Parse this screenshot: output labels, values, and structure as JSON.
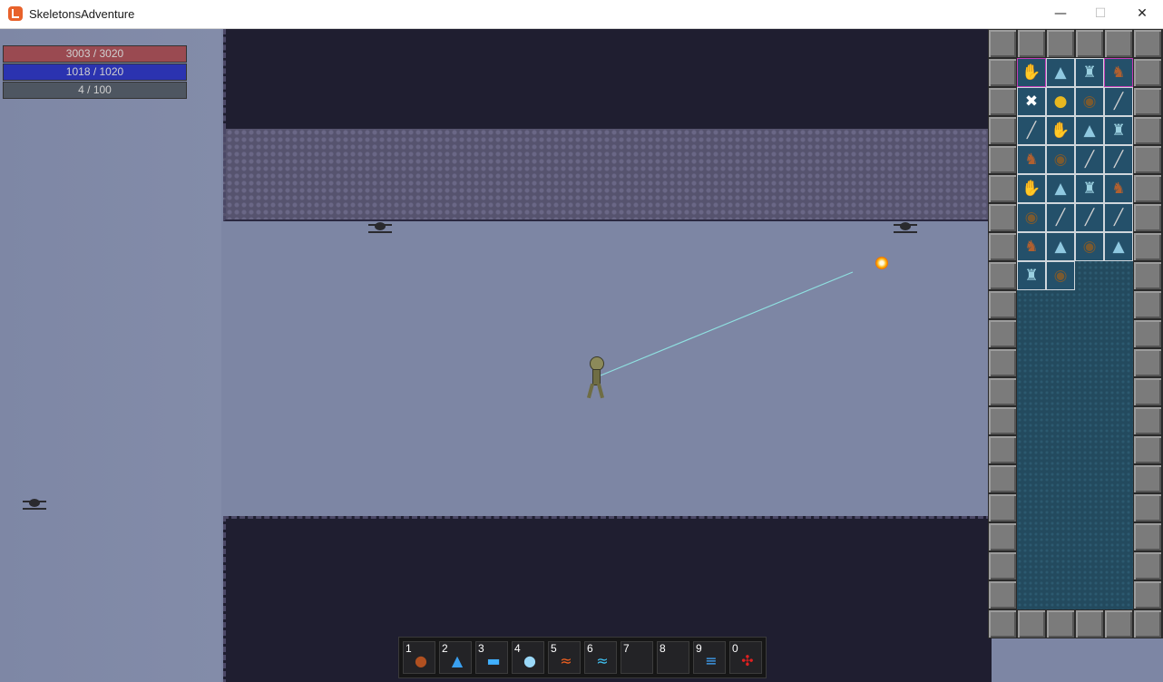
{
  "window": {
    "title": "SkeletonsAdventure",
    "minimize_glyph": "—",
    "maximize_glyph": "☐",
    "close_glyph": "✕"
  },
  "stats": {
    "health": "3003 / 3020",
    "mana": "1018 / 1020",
    "xp": "4 / 100"
  },
  "colors": {
    "health": "#9a4a51",
    "mana": "#2b33b0",
    "xp": "#4e5661",
    "laser": "#8fe0e0",
    "floor": "#7d86a4",
    "wall_dark": "#1f1e30"
  },
  "inventory": {
    "items": [
      {
        "icon": "glove-icon",
        "glyph": "✋",
        "color": "#8a6a3a",
        "highlighted": true
      },
      {
        "icon": "wizard-hat-icon",
        "glyph": "▲",
        "color": "#8fc8e0",
        "highlighted": false
      },
      {
        "icon": "robe-icon",
        "glyph": "♜",
        "color": "#9ad0e0",
        "highlighted": false
      },
      {
        "icon": "boots-icon",
        "glyph": "♞",
        "color": "#b06030",
        "highlighted": true
      },
      {
        "icon": "crossbones-icon",
        "glyph": "✖",
        "color": "#ffffff",
        "highlighted": false
      },
      {
        "icon": "gold-coins-icon",
        "glyph": "●",
        "color": "#e8b820",
        "highlighted": false
      },
      {
        "icon": "shield-icon",
        "glyph": "◉",
        "color": "#7a5a30",
        "highlighted": false
      },
      {
        "icon": "sword-icon",
        "glyph": "╱",
        "color": "#d0d0d0",
        "highlighted": false
      },
      {
        "icon": "sword-icon",
        "glyph": "╱",
        "color": "#d0d0d0",
        "highlighted": false
      },
      {
        "icon": "glove-icon",
        "glyph": "✋",
        "color": "#8a6a3a",
        "highlighted": false
      },
      {
        "icon": "wizard-hat-icon",
        "glyph": "▲",
        "color": "#8fc8e0",
        "highlighted": false
      },
      {
        "icon": "robe-icon",
        "glyph": "♜",
        "color": "#9ad0e0",
        "highlighted": false
      },
      {
        "icon": "boots-icon",
        "glyph": "♞",
        "color": "#b06030",
        "highlighted": false
      },
      {
        "icon": "shield-icon",
        "glyph": "◉",
        "color": "#7a5a30",
        "highlighted": false
      },
      {
        "icon": "sword-icon",
        "glyph": "╱",
        "color": "#d0d0d0",
        "highlighted": false
      },
      {
        "icon": "sword-icon",
        "glyph": "╱",
        "color": "#d0d0d0",
        "highlighted": false
      },
      {
        "icon": "glove-icon",
        "glyph": "✋",
        "color": "#8a6a3a",
        "highlighted": false
      },
      {
        "icon": "wizard-hat-icon",
        "glyph": "▲",
        "color": "#8fc8e0",
        "highlighted": false
      },
      {
        "icon": "robe-icon",
        "glyph": "♜",
        "color": "#9ad0e0",
        "highlighted": false
      },
      {
        "icon": "boots-icon",
        "glyph": "♞",
        "color": "#b06030",
        "highlighted": false
      },
      {
        "icon": "shield-icon",
        "glyph": "◉",
        "color": "#7a5a30",
        "highlighted": false
      },
      {
        "icon": "sword-icon",
        "glyph": "╱",
        "color": "#d0d0d0",
        "highlighted": false
      },
      {
        "icon": "sword-icon",
        "glyph": "╱",
        "color": "#d0d0d0",
        "highlighted": false
      },
      {
        "icon": "sword-icon",
        "glyph": "╱",
        "color": "#d0d0d0",
        "highlighted": false
      },
      {
        "icon": "boots-icon",
        "glyph": "♞",
        "color": "#b06030",
        "highlighted": false
      },
      {
        "icon": "wizard-hat-icon",
        "glyph": "▲",
        "color": "#8fc8e0",
        "highlighted": false
      },
      {
        "icon": "shield-icon",
        "glyph": "◉",
        "color": "#7a5a30",
        "highlighted": false
      },
      {
        "icon": "wizard-hat-icon",
        "glyph": "▲",
        "color": "#8fc8e0",
        "highlighted": false
      },
      {
        "icon": "robe-icon",
        "glyph": "♜",
        "color": "#9ad0e0",
        "highlighted": false
      },
      {
        "icon": "shield-icon",
        "glyph": "◉",
        "color": "#7a5a30",
        "highlighted": false
      }
    ]
  },
  "hotbar": {
    "slots": [
      {
        "key": "1",
        "icon": "fire-orb-icon",
        "glyph": "●",
        "color": "#b05020"
      },
      {
        "key": "2",
        "icon": "water-splash-icon",
        "glyph": "▲",
        "color": "#3aa0f0"
      },
      {
        "key": "3",
        "icon": "ice-bolt-icon",
        "glyph": "▬",
        "color": "#40b0ff"
      },
      {
        "key": "4",
        "icon": "frost-orb-icon",
        "glyph": "●",
        "color": "#9ad8f8"
      },
      {
        "key": "5",
        "icon": "fire-wave-icon",
        "glyph": "≈",
        "color": "#f06020"
      },
      {
        "key": "6",
        "icon": "ice-wave-icon",
        "glyph": "≈",
        "color": "#40c0f0"
      },
      {
        "key": "7",
        "icon": "",
        "glyph": "",
        "color": "#000000"
      },
      {
        "key": "8",
        "icon": "",
        "glyph": "",
        "color": "#000000"
      },
      {
        "key": "9",
        "icon": "multi-bolt-icon",
        "glyph": "≡",
        "color": "#40a8ff"
      },
      {
        "key": "0",
        "icon": "red-vortex-icon",
        "glyph": "✣",
        "color": "#e02020"
      }
    ]
  }
}
